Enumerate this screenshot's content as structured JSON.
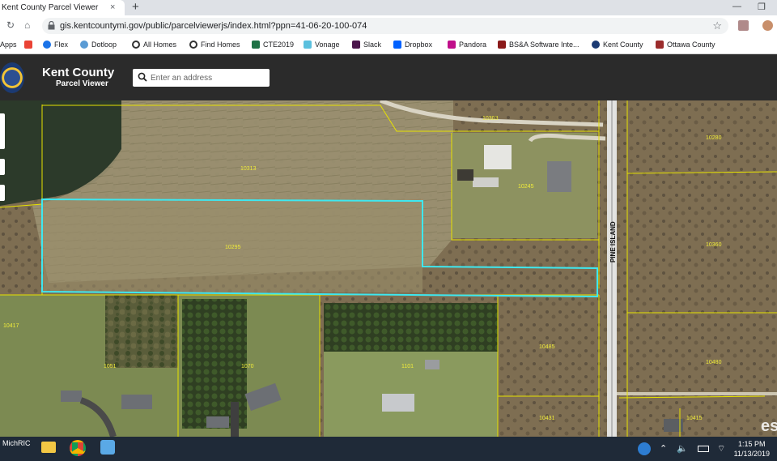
{
  "browser": {
    "tab_title": "Kent County Parcel Viewer",
    "tab_close": "×",
    "new_tab": "+",
    "url": "gis.kentcountymi.gov/public/parcelviewerjs/index.html?ppn=41-06-20-100-074",
    "star": "☆",
    "win_minimize": "—",
    "win_restore": "❐",
    "back": "←",
    "forward": "→",
    "reload": "↻",
    "menu": "⋮"
  },
  "bookmarks": [
    {
      "label": "Apps",
      "color": "#4285f4"
    },
    {
      "label": "",
      "color": "#ea4335"
    },
    {
      "label": "Flex",
      "color": "#1a73e8"
    },
    {
      "label": "Dotloop",
      "color": "#5a9bd4"
    },
    {
      "label": "All Homes",
      "color": "#333333"
    },
    {
      "label": "Find Homes",
      "color": "#333333"
    },
    {
      "label": "CTE2019",
      "color": "#1e7145"
    },
    {
      "label": "Vonage",
      "color": "#5bc0de"
    },
    {
      "label": "Slack",
      "color": "#4a154b"
    },
    {
      "label": "Dropbox",
      "color": "#0061ff"
    },
    {
      "label": "Pandora",
      "color": "#c00f8a"
    },
    {
      "label": "BS&A Software Inte...",
      "color": "#8b1a1a"
    },
    {
      "label": "Kent County",
      "color": "#1b3a73"
    },
    {
      "label": "Ottawa County",
      "color": "#9b2c2c"
    }
  ],
  "app": {
    "title": "Kent County",
    "subtitle": "Parcel Viewer",
    "search_placeholder": "Enter an address"
  },
  "map": {
    "road_label": "PINE ISLAND",
    "parcel_labels": [
      "10303",
      "10313",
      "10245",
      "10295",
      "10280",
      "10360",
      "1051",
      "1070",
      "1101",
      "10485",
      "10480",
      "10431",
      "10415",
      "10417"
    ],
    "watermark": "es"
  },
  "taskbar": {
    "left_label": "MichRIC",
    "time": "1:15 PM",
    "date": "11/13/2019"
  }
}
